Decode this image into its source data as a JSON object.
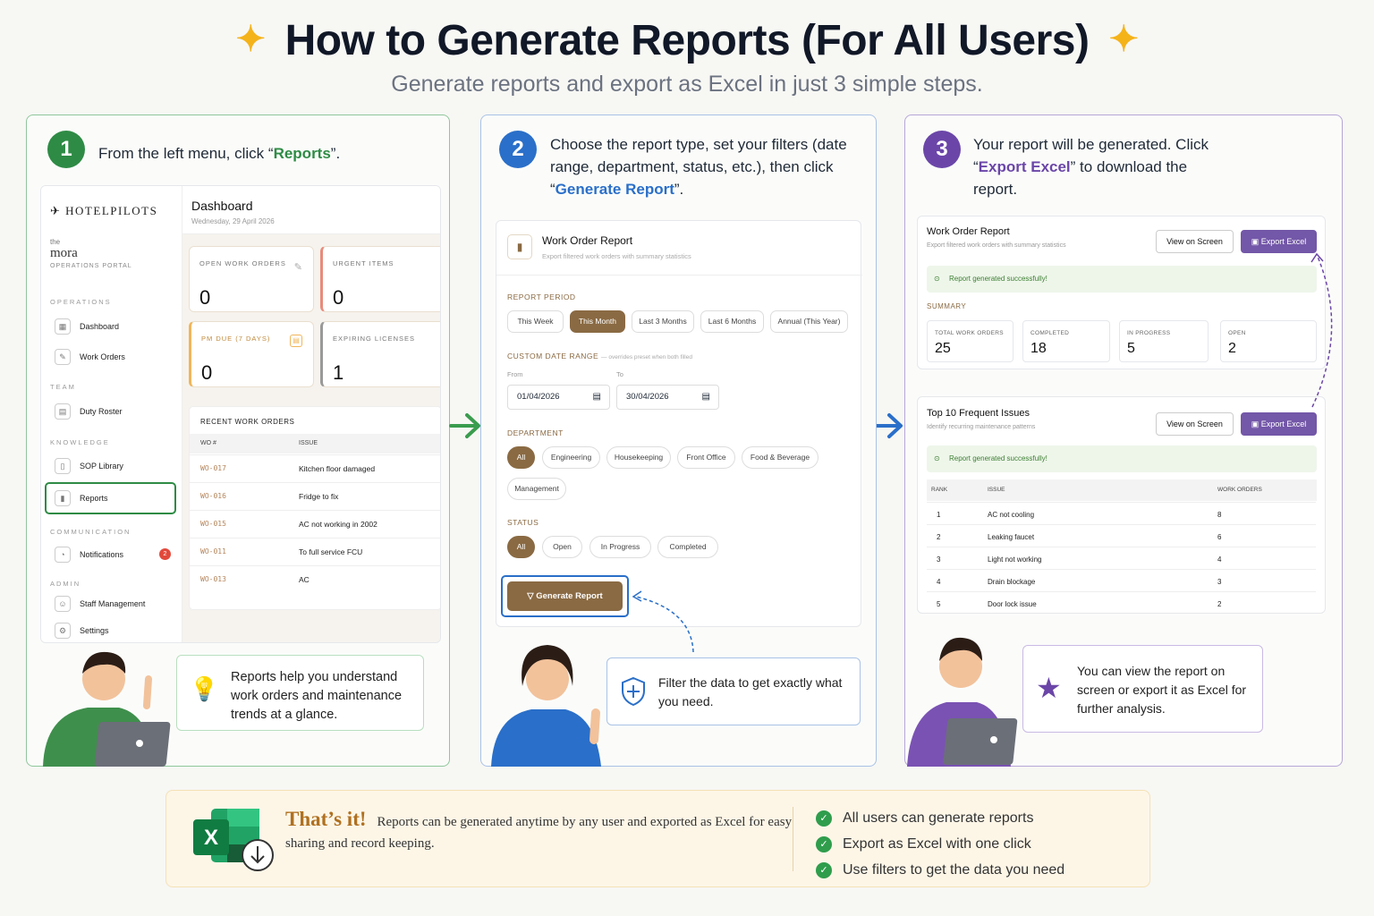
{
  "header": {
    "title": "How to Generate Reports (For All Users)",
    "subtitle": "Generate reports and export as Excel in just 3 simple steps."
  },
  "step1": {
    "number": "1",
    "text_pre": "From the left menu, click “",
    "text_highlight": "Reports",
    "text_post": "”.",
    "app": {
      "logo": "HOTELPILOTS",
      "property_small": "the",
      "property": "mora",
      "portal": "OPERATIONS PORTAL",
      "sections": {
        "operations": "OPERATIONS",
        "team": "TEAM",
        "knowledge": "KNOWLEDGE",
        "communication": "COMMUNICATION",
        "admin": "ADMIN"
      },
      "nav": {
        "dashboard": "Dashboard",
        "work_orders": "Work Orders",
        "duty_roster": "Duty Roster",
        "sop_library": "SOP Library",
        "reports": "Reports",
        "notifications": "Notifications",
        "notifications_badge": "2",
        "staff_management": "Staff Management",
        "settings": "Settings"
      },
      "page_title": "Dashboard",
      "date": "Wednesday, 29 April 2026",
      "stats": {
        "open_label": "OPEN WORK ORDERS",
        "open_value": "0",
        "urgent_label": "URGENT ITEMS",
        "urgent_value": "0",
        "pm_label": "PM DUE (7 DAYS)",
        "pm_value": "0",
        "expiring_label": "EXPIRING LICENSES",
        "expiring_value": "1"
      },
      "recent_title": "RECENT WORK ORDERS",
      "col_wo": "WO #",
      "col_issue": "ISSUE",
      "rows": [
        {
          "wo": "WO-017",
          "issue": "Kitchen floor damaged"
        },
        {
          "wo": "WO-016",
          "issue": "Fridge to fix"
        },
        {
          "wo": "WO-015",
          "issue": "AC not working in 2002"
        },
        {
          "wo": "WO-011",
          "issue": "To full service FCU"
        },
        {
          "wo": "WO-013",
          "issue": "AC"
        }
      ]
    },
    "tip": "Reports help you understand work orders and maintenance trends at a glance."
  },
  "step2": {
    "number": "2",
    "text_pre": "Choose the report type, set your filters (date range, department, status, etc.), then click “",
    "text_highlight": "Generate Report",
    "text_post": "”.",
    "card_title": "Work Order Report",
    "card_sub": "Export filtered work orders with summary statistics",
    "period_label": "REPORT PERIOD",
    "periods": [
      "This Week",
      "This Month",
      "Last 3 Months",
      "Last 6 Months",
      "Annual (This Year)"
    ],
    "custom_label": "CUSTOM DATE RANGE",
    "custom_note": "— overrides preset when both filled",
    "from_label": "From",
    "to_label": "To",
    "from_value": "01/04/2026",
    "to_value": "30/04/2026",
    "dept_label": "DEPARTMENT",
    "depts": [
      "All",
      "Engineering",
      "Housekeeping",
      "Front Office",
      "Food & Beverage",
      "Management"
    ],
    "status_label": "STATUS",
    "statuses": [
      "All",
      "Open",
      "In Progress",
      "Completed"
    ],
    "generate_label": "Generate Report",
    "tip": "Filter the data to get exactly what you need."
  },
  "step3": {
    "number": "3",
    "text_pre": "Your report will be generated. Click “",
    "text_highlight": "Export Excel",
    "text_post": "” to download the report.",
    "report1": {
      "title": "Work Order Report",
      "sub": "Export filtered work orders with summary statistics",
      "view": "View on Screen",
      "export": "Export Excel",
      "success": "Report generated successfully!",
      "summary_label": "SUMMARY",
      "stats": [
        {
          "label": "TOTAL WORK ORDERS",
          "value": "25"
        },
        {
          "label": "COMPLETED",
          "value": "18"
        },
        {
          "label": "IN PROGRESS",
          "value": "5"
        },
        {
          "label": "OPEN",
          "value": "2"
        }
      ]
    },
    "report2": {
      "title": "Top 10 Frequent Issues",
      "sub": "Identify recurring maintenance patterns",
      "view": "View on Screen",
      "export": "Export Excel",
      "success": "Report generated successfully!",
      "col_rank": "RANK",
      "col_issue": "ISSUE",
      "col_wo": "WORK ORDERS",
      "rows": [
        {
          "rank": "1",
          "issue": "AC not cooling",
          "count": "8"
        },
        {
          "rank": "2",
          "issue": "Leaking faucet",
          "count": "6"
        },
        {
          "rank": "3",
          "issue": "Light not working",
          "count": "4"
        },
        {
          "rank": "4",
          "issue": "Drain blockage",
          "count": "3"
        },
        {
          "rank": "5",
          "issue": "Door lock issue",
          "count": "2"
        }
      ]
    },
    "tip": "You can view the report on screen or export it as Excel for further analysis."
  },
  "footer": {
    "headline": "That’s it!",
    "text": "Reports can be generated anytime by any user and exported as Excel for easy sharing and record keeping.",
    "checks": [
      "All users can generate reports",
      "Export as Excel with one click",
      "Use filters to get the data you need"
    ]
  },
  "colors": {
    "green": "#2e8b45",
    "blue": "#2a6fc9",
    "purple": "#6b46a8",
    "brown": "#8a6a43",
    "gold": "#f5b31a"
  }
}
